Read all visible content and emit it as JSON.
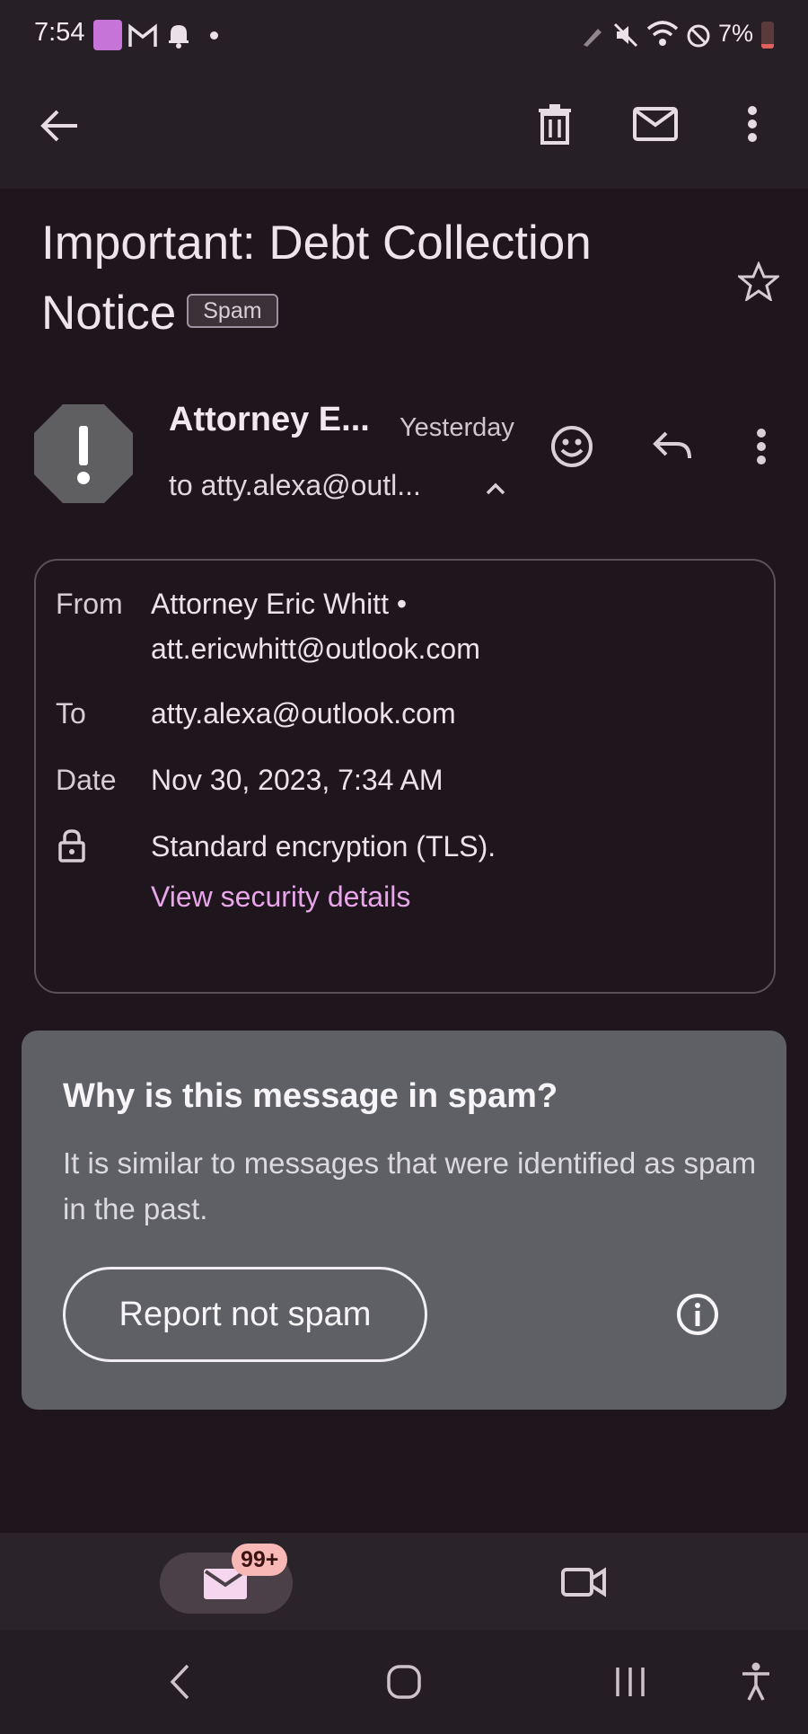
{
  "status_bar": {
    "time": "7:54",
    "battery": "7%"
  },
  "app_bar": {
    "actions": [
      "back-arrow-icon",
      "delete-icon",
      "mark-unread-icon",
      "more-vert-icon"
    ]
  },
  "email": {
    "subject": "Important: Debt Collection Notice",
    "label": "Spam",
    "sender_short": "Attorney E...",
    "time_short": "Yesterday",
    "to_short": "to atty.alexa@outl..."
  },
  "details": {
    "from_label": "From",
    "from_name": "Attorney Eric Whitt •",
    "from_email": "att.ericwhitt@outlook.com",
    "to_label": "To",
    "to_value": "atty.alexa@outlook.com",
    "date_label": "Date",
    "date_value": "Nov 30, 2023, 7:34 AM",
    "security_text": "Standard encryption (TLS).",
    "security_link": "View security details"
  },
  "spam_card": {
    "title": "Why is this message in spam?",
    "body": "It is similar to messages that were identified as spam in the past.",
    "button": "Report not spam"
  },
  "bottom_nav": {
    "mail_badge": "99+"
  },
  "colors": {
    "background": "#1e161c",
    "link": "#e8a5ea",
    "card": "#5e6065",
    "badge": "#f8b9b6"
  }
}
